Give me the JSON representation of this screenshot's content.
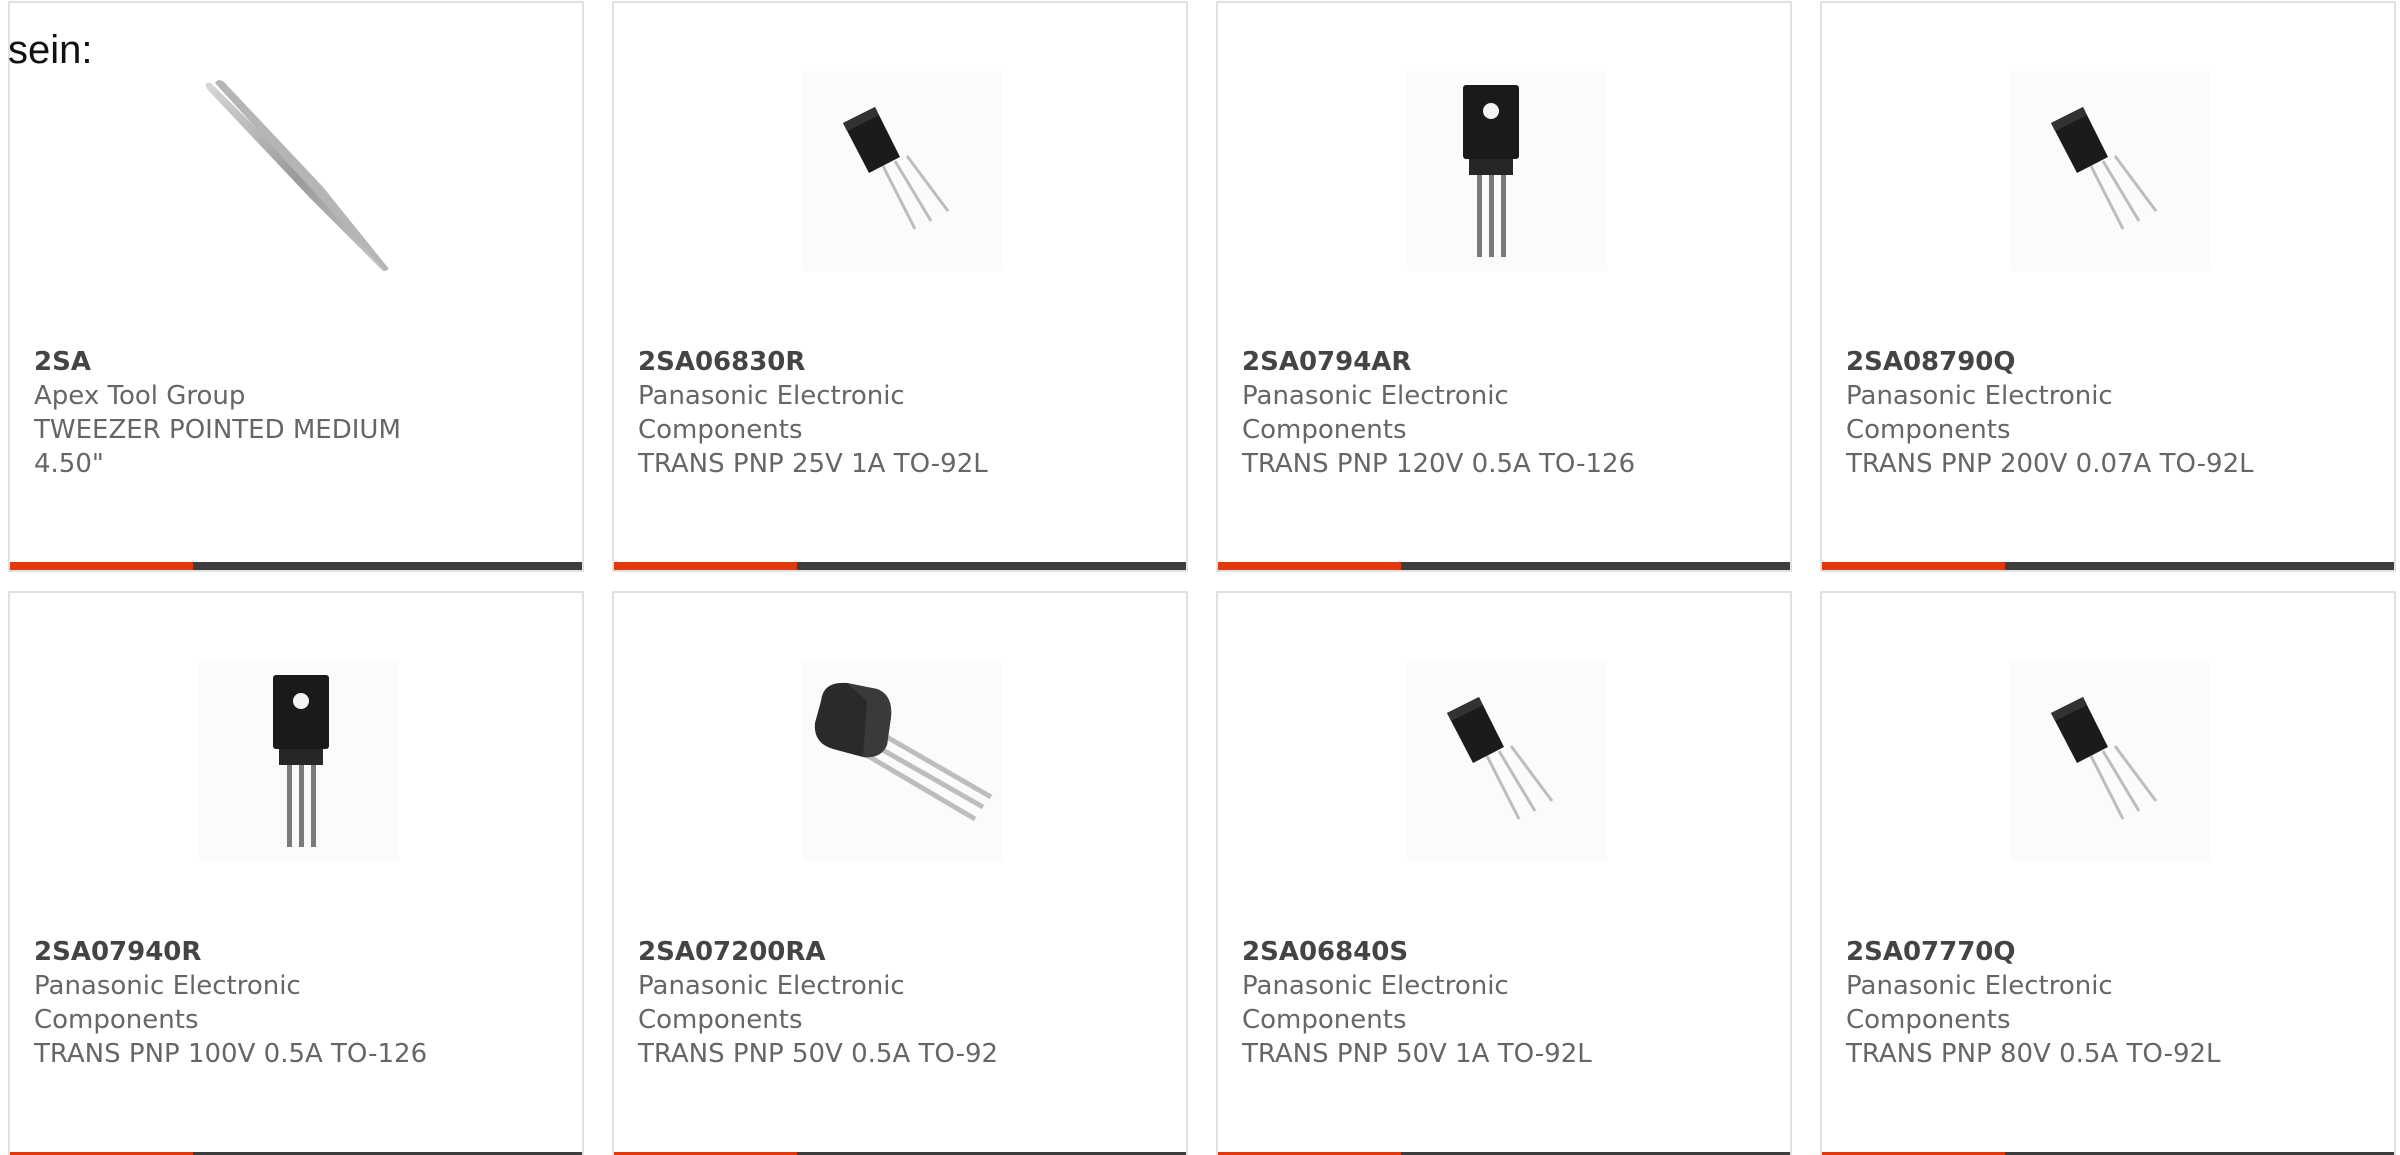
{
  "intro_text": "sein:",
  "colors": {
    "accent": "#e2380b",
    "bar": "#3d3d3d",
    "border": "#e1e1e1",
    "text": "#666666",
    "title": "#444444"
  },
  "products": [
    {
      "part": "2SA",
      "manufacturer": "Apex Tool Group",
      "description": "TWEEZER POINTED MEDIUM 4.50\"",
      "image": "tweezer-icon"
    },
    {
      "part": "2SA06830R",
      "manufacturer": "Panasonic Electronic Components",
      "description": "TRANS PNP 25V 1A TO-92L",
      "image": "to92l-transistor-icon"
    },
    {
      "part": "2SA0794AR",
      "manufacturer": "Panasonic Electronic Components",
      "description": "TRANS PNP 120V 0.5A TO-126",
      "image": "to126-transistor-icon"
    },
    {
      "part": "2SA08790Q",
      "manufacturer": "Panasonic Electronic Components",
      "description": "TRANS PNP 200V 0.07A TO-92L",
      "image": "to92l-transistor-icon"
    },
    {
      "part": "2SA07940R",
      "manufacturer": "Panasonic Electronic Components",
      "description": "TRANS PNP 100V 0.5A TO-126",
      "image": "to126-transistor-icon"
    },
    {
      "part": "2SA07200RA",
      "manufacturer": "Panasonic Electronic Components",
      "description": "TRANS PNP 50V 0.5A TO-92",
      "image": "to92-transistor-icon"
    },
    {
      "part": "2SA06840S",
      "manufacturer": "Panasonic Electronic Components",
      "description": "TRANS PNP 50V 1A TO-92L",
      "image": "to92l-transistor-icon"
    },
    {
      "part": "2SA07770Q",
      "manufacturer": "Panasonic Electronic Components",
      "description": "TRANS PNP 80V 0.5A TO-92L",
      "image": "to92l-transistor-icon"
    }
  ]
}
